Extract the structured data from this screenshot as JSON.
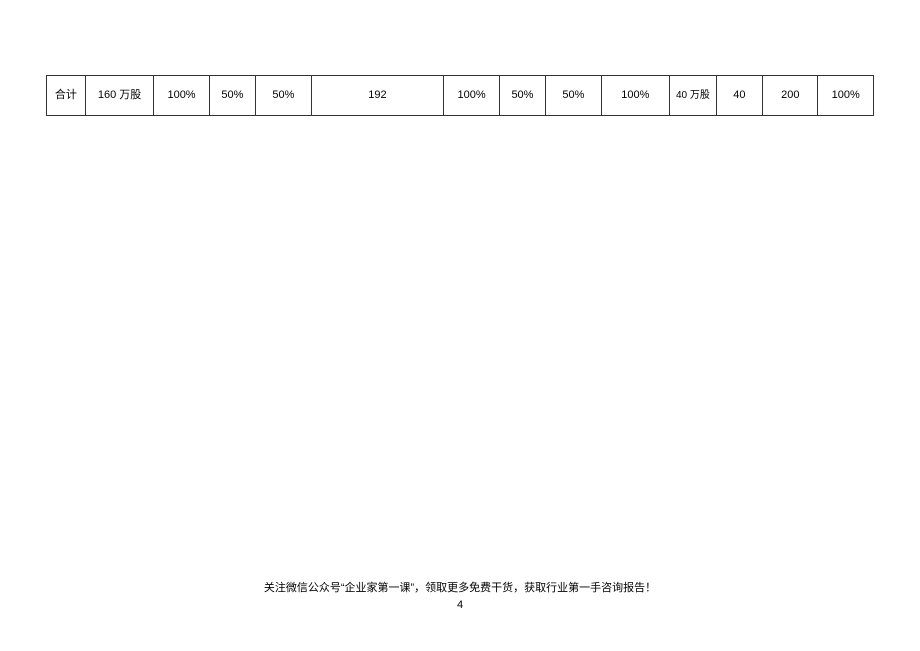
{
  "table": {
    "row": [
      "合计",
      "160 万股",
      "100%",
      "50%",
      "50%",
      "192",
      "100%",
      "50%",
      "50%",
      "100%",
      "40 万股",
      "40",
      "200",
      "100%"
    ]
  },
  "footer": {
    "text": "关注微信公众号“企业家第一课”，领取更多免费干货，获取行业第一手咨询报告！",
    "page_number": "4"
  }
}
